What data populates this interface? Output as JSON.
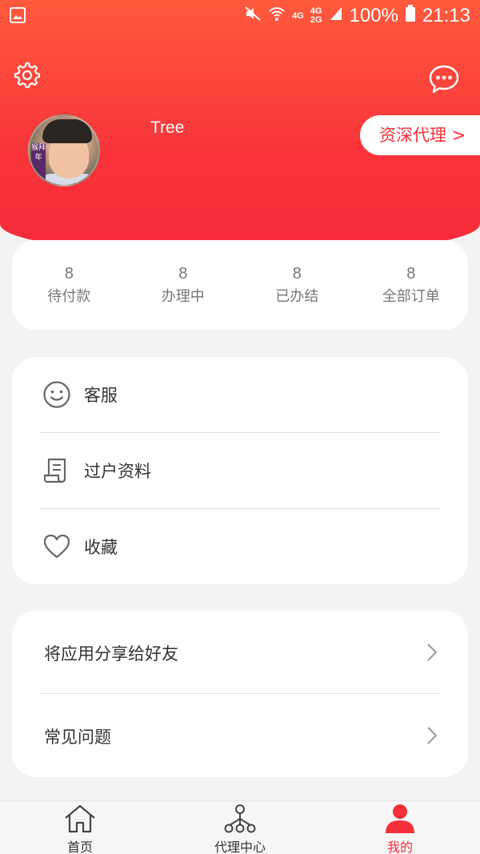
{
  "status_bar": {
    "network_top": "4G",
    "network_stack_a": "4G",
    "network_stack_b": "2G",
    "battery": "100%",
    "time": "21:13"
  },
  "profile": {
    "username": "Tree",
    "level_label": "资深代理 >",
    "avatar_sticker": "猴拜年"
  },
  "orders": [
    {
      "count": "8",
      "label": "待付款"
    },
    {
      "count": "8",
      "label": "办理中"
    },
    {
      "count": "8",
      "label": "已办结"
    },
    {
      "count": "8",
      "label": "全部订单"
    }
  ],
  "menu": [
    {
      "label": "客服",
      "icon": "smiley-icon"
    },
    {
      "label": "过户资料",
      "icon": "document-icon"
    },
    {
      "label": "收藏",
      "icon": "heart-icon"
    }
  ],
  "more": [
    {
      "label": "将应用分享给好友"
    },
    {
      "label": "常见问题"
    }
  ],
  "tabs": [
    {
      "label": "首页",
      "icon": "home-icon",
      "active": false
    },
    {
      "label": "代理中心",
      "icon": "network-icon",
      "active": false
    },
    {
      "label": "我的",
      "icon": "person-icon",
      "active": true
    }
  ],
  "colors": {
    "accent": "#f52f3a",
    "header_top": "#ff5a3d",
    "header_bottom": "#f52a3a",
    "background": "#f3f3f3"
  }
}
